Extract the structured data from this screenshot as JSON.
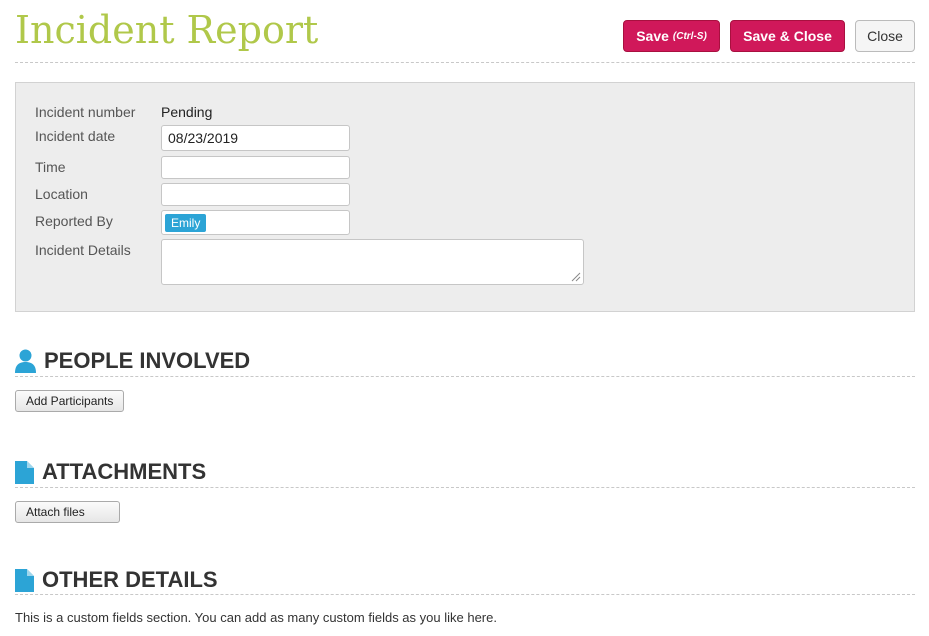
{
  "header": {
    "title": "Incident Report",
    "save_label": "Save",
    "save_hint": "(Ctrl-S)",
    "save_close_label": "Save & Close",
    "close_label": "Close"
  },
  "form": {
    "incident_number_label": "Incident number",
    "incident_number_value": "Pending",
    "incident_date_label": "Incident date",
    "incident_date_value": "08/23/2019",
    "time_label": "Time",
    "time_value": "",
    "location_label": "Location",
    "location_value": "",
    "reported_by_label": "Reported By",
    "reported_by_tag": "Emily",
    "incident_details_label": "Incident Details",
    "incident_details_value": ""
  },
  "sections": {
    "people": {
      "title": "PEOPLE INVOLVED",
      "icon": "person-icon",
      "button_label": "Add Participants"
    },
    "attachments": {
      "title": "ATTACHMENTS",
      "icon": "document-icon",
      "button_label": "Attach files"
    },
    "other": {
      "title": "OTHER DETAILS",
      "icon": "document-icon",
      "description": "This is a custom fields section. You can add as many custom fields as you like here."
    }
  },
  "colors": {
    "title": "#b0c84a",
    "primary_button": "#d0185a",
    "icon": "#2ca4d6",
    "tag": "#2ca4d6"
  }
}
